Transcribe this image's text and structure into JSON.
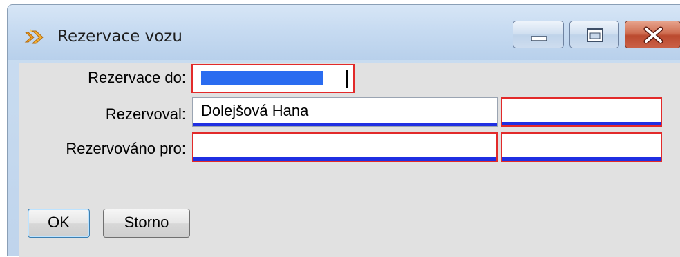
{
  "window": {
    "title": "Rezervace vozu",
    "icon": "app-icon",
    "controls": [
      "minimize-icon",
      "maximize-icon",
      "close-icon"
    ]
  },
  "form": {
    "reserved_until": {
      "label": "Rezervace do:",
      "value": ""
    },
    "reserved_by": {
      "label": "Rezervoval:",
      "name": "Dolejšová Hana",
      "extra": ""
    },
    "reserved_for": {
      "label": "Rezervováno pro:",
      "name": "",
      "extra": ""
    }
  },
  "buttons": {
    "ok": "OK",
    "cancel": "Storno"
  },
  "colors": {
    "field_border_error": "#e22a2a",
    "field_underline": "#1f2fe2",
    "selection": "#2a6cf0",
    "client_bg": "#e1e1e1"
  }
}
